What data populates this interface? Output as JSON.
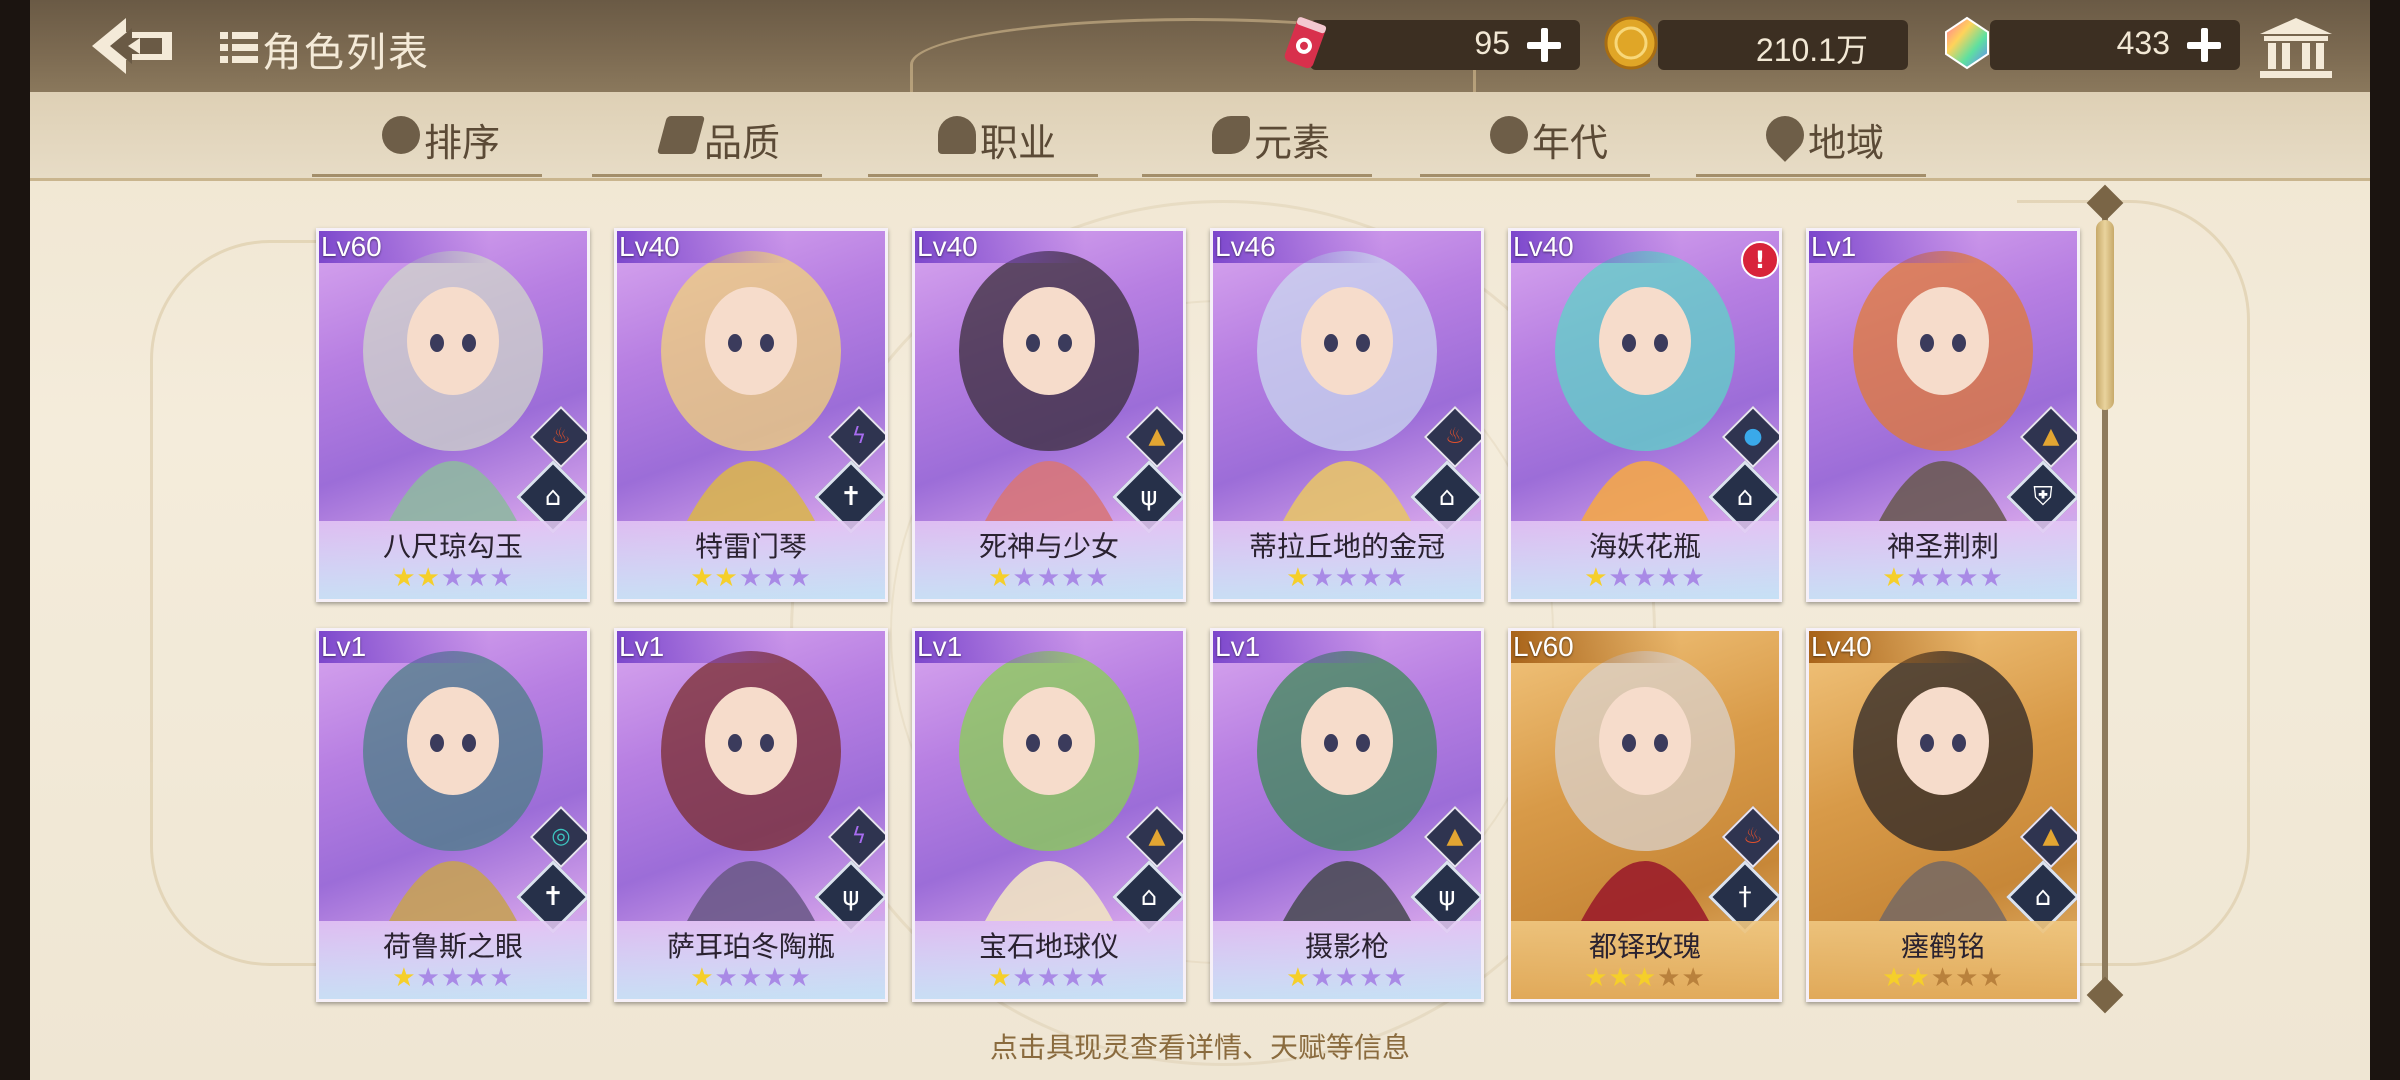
{
  "header": {
    "back_label": "",
    "title": "角色列表",
    "resources": [
      {
        "name": "stamina",
        "icon": "soda-can-icon",
        "value": "95"
      },
      {
        "name": "coins",
        "icon": "gold-coin-icon",
        "value": "210.1万"
      },
      {
        "name": "gems",
        "icon": "rainbow-gem-icon",
        "value": "433"
      }
    ]
  },
  "filters": [
    {
      "label": "排序",
      "icon": "sort-icon"
    },
    {
      "label": "品质",
      "icon": "quality-icon"
    },
    {
      "label": "职业",
      "icon": "class-icon"
    },
    {
      "label": "元素",
      "icon": "element-icon"
    },
    {
      "label": "年代",
      "icon": "era-icon"
    },
    {
      "label": "地域",
      "icon": "location-pin-icon"
    }
  ],
  "cards": [
    {
      "level": "Lv60",
      "name": "八尺琼勾玉",
      "stars": 2,
      "rarity": "purple",
      "element": "fire",
      "job": "book"
    },
    {
      "level": "Lv40",
      "name": "特雷门琴",
      "stars": 2,
      "rarity": "purple",
      "element": "thunder",
      "job": "cross"
    },
    {
      "level": "Lv40",
      "name": "死神与少女",
      "stars": 1,
      "rarity": "purple",
      "element": "earth",
      "job": "fork"
    },
    {
      "level": "Lv46",
      "name": "蒂拉丘地的金冠",
      "stars": 1,
      "rarity": "purple",
      "element": "fire",
      "job": "book"
    },
    {
      "level": "Lv40",
      "name": "海妖花瓶",
      "stars": 1,
      "rarity": "purple",
      "element": "water",
      "job": "book",
      "alert": "!"
    },
    {
      "level": "Lv1",
      "name": "神圣荆刺",
      "stars": 1,
      "rarity": "purple",
      "element": "earth",
      "job": "shield"
    },
    {
      "level": "Lv1",
      "name": "荷鲁斯之眼",
      "stars": 1,
      "rarity": "purple",
      "element": "wind",
      "job": "cross"
    },
    {
      "level": "Lv1",
      "name": "萨耳珀冬陶瓶",
      "stars": 1,
      "rarity": "purple",
      "element": "thunder",
      "job": "fork"
    },
    {
      "level": "Lv1",
      "name": "宝石地球仪",
      "stars": 1,
      "rarity": "purple",
      "element": "earth",
      "job": "book"
    },
    {
      "level": "Lv1",
      "name": "摄影枪",
      "stars": 1,
      "rarity": "purple",
      "element": "earth",
      "job": "fork"
    },
    {
      "level": "Lv60",
      "name": "都铎玫瑰",
      "stars": 3,
      "rarity": "gold",
      "element": "fire",
      "job": "sword"
    },
    {
      "level": "Lv40",
      "name": "瘗鹤铭",
      "stars": 2,
      "rarity": "gold",
      "element": "earth",
      "job": "book"
    }
  ],
  "max_stars": 5,
  "footer_hint": "点击具现灵查看详情、天赋等信息",
  "colors": {
    "topbar": "#6a5a45",
    "background": "#efe4cf",
    "star_on": "#f5cf2a",
    "fire": "#e2502c",
    "thunder": "#a86cf0",
    "earth": "#e3a532",
    "water": "#3aa9ea",
    "wind": "#3cc6c0"
  }
}
